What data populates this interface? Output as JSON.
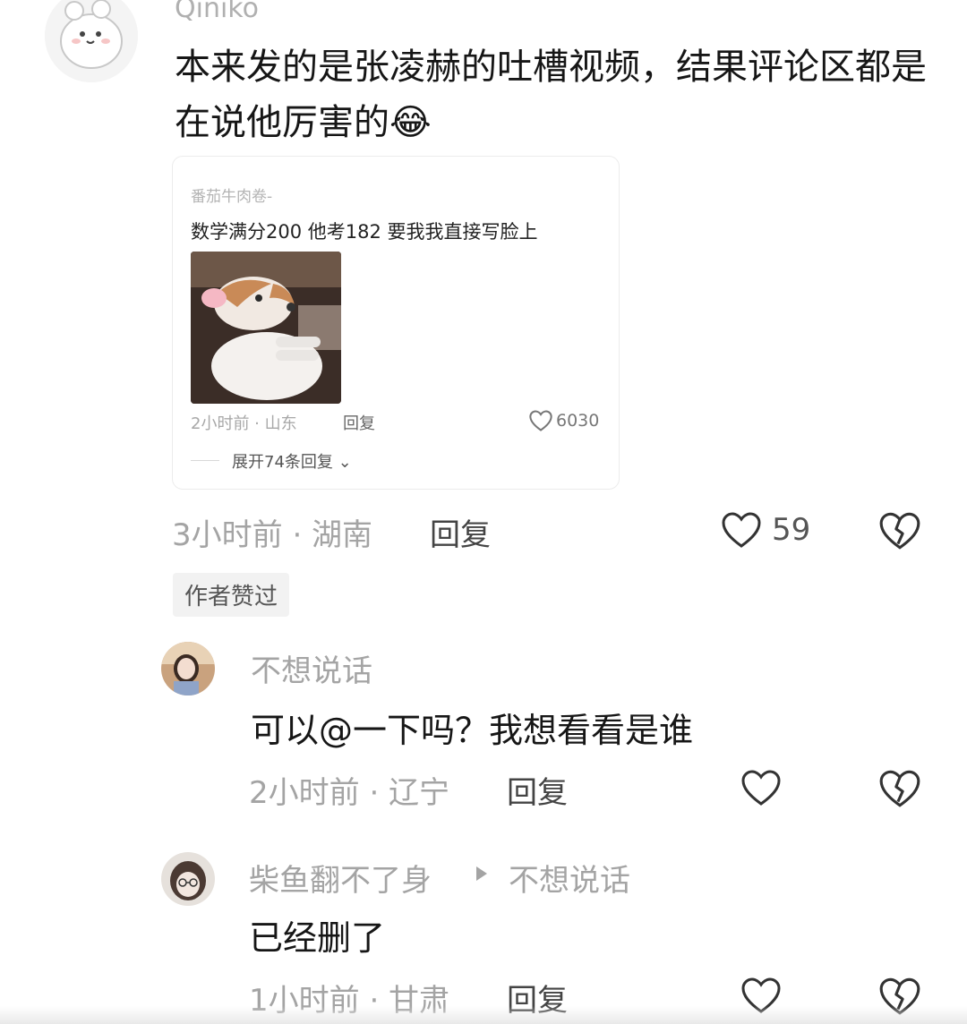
{
  "main_comment": {
    "username": "Qiniko",
    "text": "本来发的是张凌赫的吐槽视频，结果评论区都是在说他厉害的😂",
    "quote": {
      "author": "番茄牛肉卷-",
      "text": "数学满分200 他考182 要我我直接写脸上",
      "meta": "2小时前 · 山东",
      "reply_label": "回复",
      "likes": "6030",
      "expand_label": "展开74条回复 ⌄"
    },
    "meta": "3小时前 · 湖南",
    "reply_label": "回复",
    "likes": "59",
    "badge": "作者赞过"
  },
  "replies": [
    {
      "username": "不想说话",
      "text": "可以@一下吗？我想看看是谁",
      "meta": "2小时前 · 辽宁",
      "reply_label": "回复"
    },
    {
      "username": "柴鱼翻不了身",
      "reply_to": "不想说话",
      "text": "已经删了",
      "meta": "1小时前 · 甘肃",
      "reply_label": "回复"
    }
  ],
  "icons": {
    "like": "heart-outline-icon",
    "dislike": "broken-heart-icon",
    "reply_arrow": "play-triangle-icon"
  },
  "colors": {
    "text": "#161616",
    "meta": "#a4a4a4",
    "icon": "#333333"
  }
}
